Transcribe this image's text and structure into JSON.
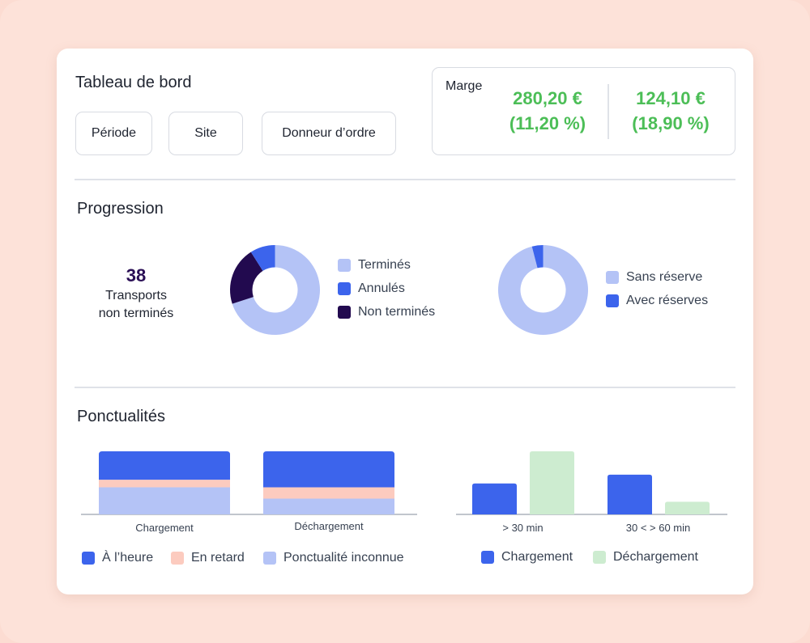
{
  "header": {
    "title": "Tableau de bord",
    "filters": [
      "Période",
      "Site",
      "Donneur d’ordre"
    ]
  },
  "marge": {
    "label": "Marge",
    "values": [
      {
        "amount": "280,20 €",
        "percent": "(11,20 %)"
      },
      {
        "amount": "124,10 €",
        "percent": "(18,90 %)"
      }
    ]
  },
  "progression": {
    "title": "Progression",
    "kpi": {
      "value": "38",
      "label_line1": "Transports",
      "label_line2": "non terminés"
    },
    "donut1": {
      "slices": [
        {
          "name": "Terminés",
          "share": 0.7,
          "color": "#b4c3f6"
        },
        {
          "name": "Non terminés",
          "share": 0.21,
          "color": "#220a4f"
        },
        {
          "name": "Annulés",
          "share": 0.09,
          "color": "#3c64ec"
        }
      ],
      "legend": [
        "Terminés",
        "Annulés",
        "Non terminés"
      ]
    },
    "donut2": {
      "slices": [
        {
          "name": "Sans réserve",
          "share": 0.96,
          "color": "#b4c3f6"
        },
        {
          "name": "Avec réserves",
          "share": 0.04,
          "color": "#3c64ec"
        }
      ],
      "legend": [
        "Sans réserve",
        "Avec réserves"
      ]
    }
  },
  "ponctualites": {
    "title": "Ponctualités",
    "legend_left": [
      "À l’heure",
      "En retard",
      "Ponctualité inconnue"
    ],
    "legend_right": [
      "Chargement",
      "Déchargement"
    ]
  },
  "colors": {
    "primary": "#3c64ec",
    "light": "#b4c3f6",
    "dark": "#220a4f",
    "late": "#fccbbf",
    "unload": "#cdecd0",
    "green": "#4cbe57"
  },
  "chart_data": [
    {
      "type": "pie",
      "labels": [
        "Terminés",
        "Annulés",
        "Non terminés"
      ],
      "values": [
        70,
        9,
        21
      ]
    },
    {
      "type": "pie",
      "labels": [
        "Sans réserve",
        "Avec réserves"
      ],
      "values": [
        96,
        4
      ]
    },
    {
      "type": "bar",
      "stacked": true,
      "categories": [
        "Chargement",
        "Déchargement"
      ],
      "series": [
        {
          "name": "Ponctualité inconnue",
          "values": [
            43,
            25
          ]
        },
        {
          "name": "En retard",
          "values": [
            12,
            18
          ]
        },
        {
          "name": "À l’heure",
          "values": [
            45,
            57
          ]
        }
      ],
      "ylim": [
        0,
        100
      ]
    },
    {
      "type": "bar",
      "categories": [
        "> 30 min",
        "30 <  > 60 min"
      ],
      "series": [
        {
          "name": "Chargement",
          "values": [
            49,
            63
          ]
        },
        {
          "name": "Déchargement",
          "values": [
            100,
            20
          ]
        }
      ],
      "ylim": [
        0,
        100
      ]
    }
  ]
}
